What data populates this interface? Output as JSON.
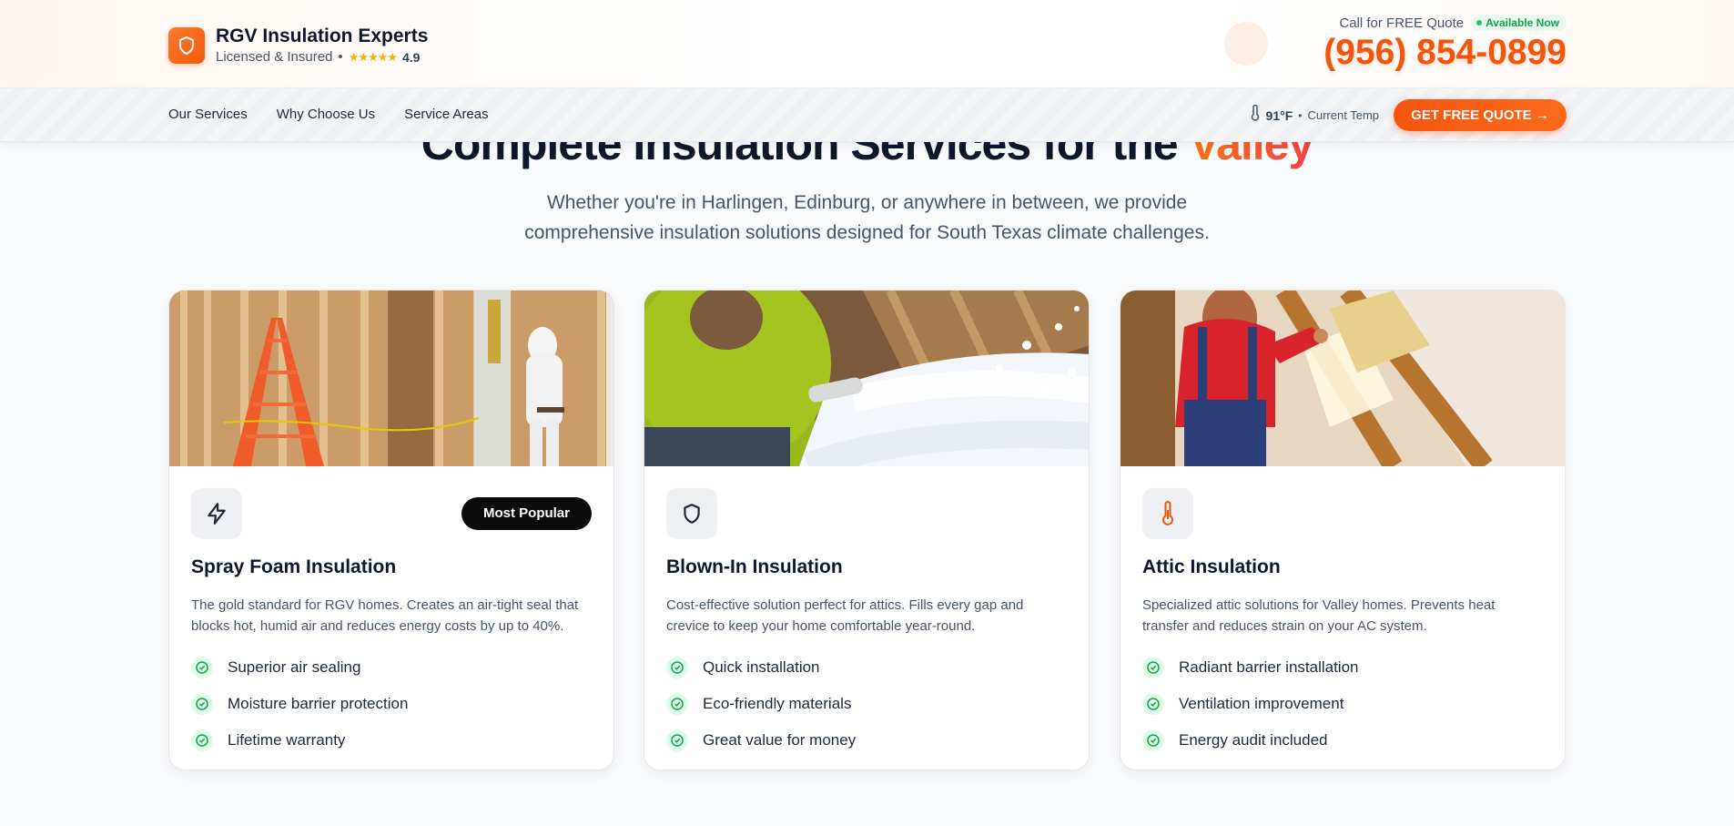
{
  "brand": {
    "name": "RGV Insulation Experts",
    "subtitle": "Licensed & Insured",
    "separator": "•",
    "stars": "★★★★★",
    "rating": "4.9"
  },
  "call": {
    "label": "Call for FREE Quote",
    "availability": "Available Now",
    "phone": "(956) 854-0899"
  },
  "nav": {
    "items": [
      {
        "label": "Our Services"
      },
      {
        "label": "Why Choose Us"
      },
      {
        "label": "Service Areas"
      }
    ],
    "temperature": "91°F",
    "temperature_separator": "•",
    "temperature_label": "Current Temp",
    "quote_button": "GET FREE QUOTE →"
  },
  "hero": {
    "headline_main": "Complete Insulation Services for the ",
    "headline_accent": "Valley",
    "subtext_line1": "Whether you're in Harlingen, Edinburg, or anywhere in between, we provide",
    "subtext_line2": "comprehensive insulation solutions designed for South Texas climate challenges."
  },
  "cards": [
    {
      "icon": "lightning-icon",
      "badge": "Most Popular",
      "title": "Spray Foam Insulation",
      "description": "The gold standard for RGV homes. Creates an air-tight seal that blocks hot, humid air and reduces energy costs by up to 40%.",
      "features": [
        "Superior air sealing",
        "Moisture barrier protection",
        "Lifetime warranty"
      ]
    },
    {
      "icon": "shield-icon",
      "title": "Blown-In Insulation",
      "description": "Cost-effective solution perfect for attics. Fills every gap and crevice to keep your home comfortable year-round.",
      "features": [
        "Quick installation",
        "Eco-friendly materials",
        "Great value for money"
      ]
    },
    {
      "icon": "thermometer-icon",
      "title": "Attic Insulation",
      "description": "Specialized attic solutions for Valley homes. Prevents heat transfer and reduces strain on your AC system.",
      "features": [
        "Radiant barrier installation",
        "Ventilation improvement",
        "Energy audit included"
      ]
    }
  ],
  "colors": {
    "accent": "#f0560e",
    "success": "#16a34a",
    "text_dark": "#0f172a",
    "text_muted": "#475569"
  }
}
